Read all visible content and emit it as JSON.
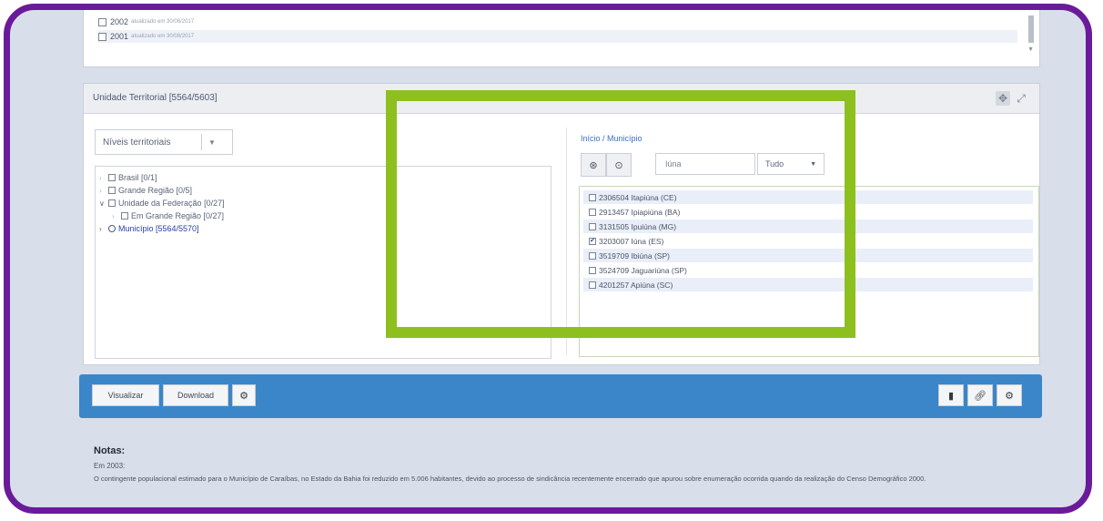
{
  "years": [
    {
      "label": "2002",
      "updated": "atualizado em 30/08/2017"
    },
    {
      "label": "2001",
      "updated": "atualizado em 30/08/2017"
    }
  ],
  "panel": {
    "title": "Unidade Territorial [5564/5603]",
    "select_label": "Níveis territoriais",
    "tree": [
      {
        "label": "Brasil [0/1]"
      },
      {
        "label": "Grande Região [0/5]"
      },
      {
        "label": "Unidade da Federação [0/27]"
      },
      {
        "label": "Em Grande Região [0/27]"
      },
      {
        "label": "Município [5564/5570]"
      }
    ],
    "breadcrumb": "Início / Município",
    "search_value": "Iúna",
    "filter_value": "Tudo",
    "results": [
      {
        "label": "2306504 Itapiúna (CE)",
        "checked": false
      },
      {
        "label": "2913457 Ipiapiúna (BA)",
        "checked": false
      },
      {
        "label": "3131505 Ipuiúna (MG)",
        "checked": false
      },
      {
        "label": "3203007 Iúna (ES)",
        "checked": true
      },
      {
        "label": "3519709 Ibiúna (SP)",
        "checked": false
      },
      {
        "label": "3524709 Jaguariúna (SP)",
        "checked": false
      },
      {
        "label": "4201257 Apiúna (SC)",
        "checked": false
      }
    ]
  },
  "toolbar": {
    "visualizar": "Visualizar",
    "download": "Download"
  },
  "notes": {
    "title": "Notas:",
    "year": "Em 2003:",
    "text": "O contingente populacional estimado para o Município de Caraíbas, no Estado da Bahia foi reduzido em 5.006 habitantes, devido ao processo de sindicância recentemente encerrado que apurou sobre enumeração ocorrida quando da realização do Censo Demográfico 2000."
  },
  "colors": {
    "frame": "#6a1b9a",
    "highlight": "#8dc01f",
    "toolbar": "#3b86c8"
  }
}
